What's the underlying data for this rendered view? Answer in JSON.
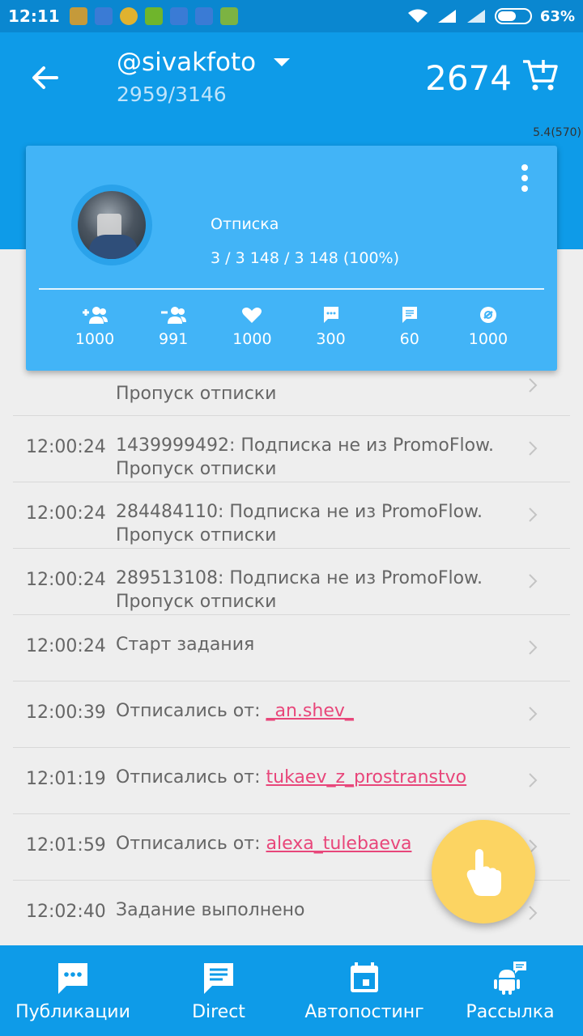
{
  "status_bar": {
    "time": "12:11",
    "battery": "63%",
    "battery_level": 0.63
  },
  "header": {
    "account": "@sivakfoto",
    "account_count": "2959/3146",
    "credits": "2674",
    "version": "5.4(570)"
  },
  "card": {
    "task_title": "Отписка",
    "task_progress": "3 / 3 148 / 3 148 (100%)",
    "stats": [
      {
        "icon": "follow-icon",
        "value": "1000"
      },
      {
        "icon": "unfollow-icon",
        "value": "991"
      },
      {
        "icon": "like-icon",
        "value": "1000"
      },
      {
        "icon": "comment-icon",
        "value": "300"
      },
      {
        "icon": "message-icon",
        "value": "60"
      },
      {
        "icon": "story-icon",
        "value": "1000"
      }
    ]
  },
  "log": [
    {
      "time": "",
      "text": "Пропуск отписки",
      "user": ""
    },
    {
      "time": "12:00:24",
      "text": "1439999492: Подписка не из PromoFlow. Пропуск отписки",
      "user": ""
    },
    {
      "time": "12:00:24",
      "text": "284484110: Подписка не из PromoFlow. Пропуск отписки",
      "user": ""
    },
    {
      "time": "12:00:24",
      "text": "289513108: Подписка не из PromoFlow. Пропуск отписки",
      "user": ""
    },
    {
      "time": "12:00:24",
      "text": "Старт задания",
      "user": ""
    },
    {
      "time": "12:00:39",
      "text": "Отписались от:",
      "user": "_an.shev_"
    },
    {
      "time": "12:01:19",
      "text": "Отписались от:",
      "user": "tukaev_z_prostranstvo"
    },
    {
      "time": "12:01:59",
      "text": "Отписались от:",
      "user": "alexa_tulebaeva"
    },
    {
      "time": "12:02:40",
      "text": "Задание выполнено",
      "user": ""
    }
  ],
  "bottom_nav": [
    {
      "label": "Публикации",
      "icon": "publications-icon"
    },
    {
      "label": "Direct",
      "icon": "direct-icon"
    },
    {
      "label": "Автопостинг",
      "icon": "calendar-icon"
    },
    {
      "label": "Рассылка",
      "icon": "android-icon"
    }
  ],
  "colors": {
    "primary": "#0e9be8",
    "card": "#42b4f7",
    "accent": "#fcd462",
    "link": "#e8467a"
  }
}
